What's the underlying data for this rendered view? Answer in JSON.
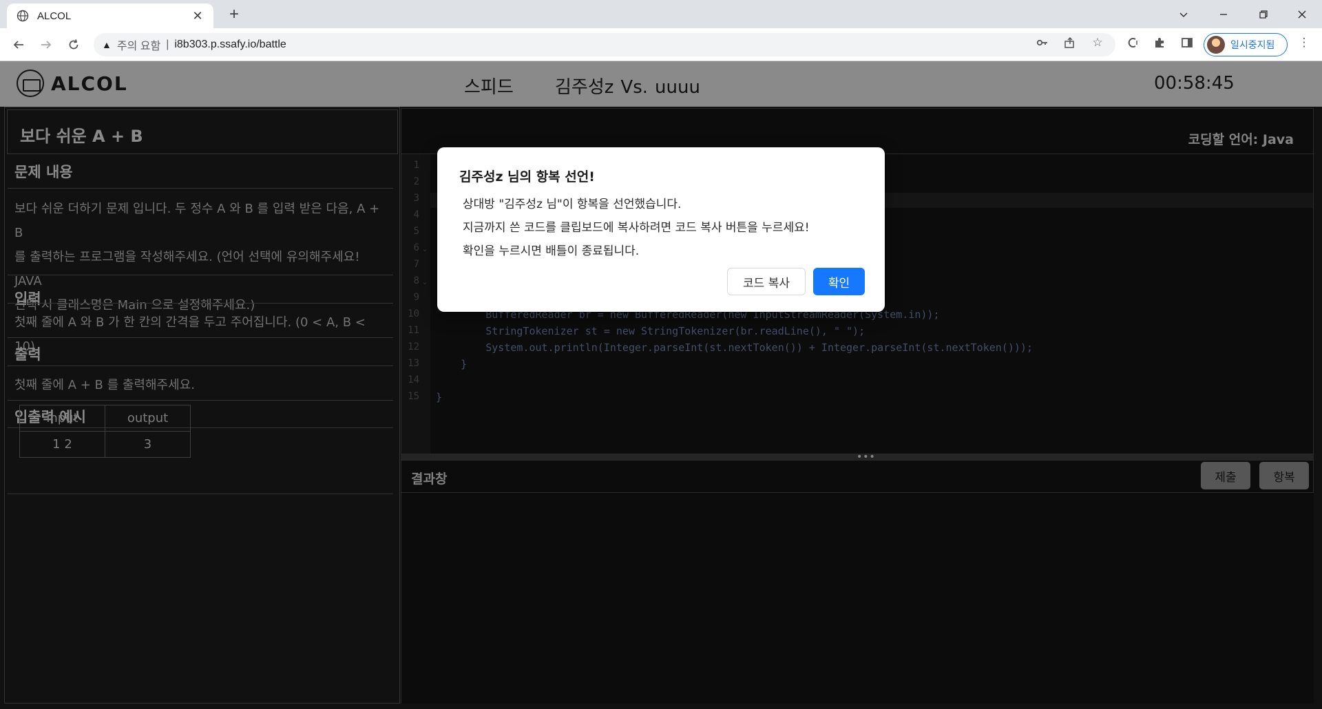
{
  "browser": {
    "tab_title": "ALCOL",
    "tab_close": "✕",
    "new_tab": "+",
    "security_warning": "주의 요함",
    "separator": "|",
    "url": "i8b303.p.ssafy.io/battle",
    "profile_label": "일시중지됨"
  },
  "header": {
    "logo_text": "ALCOL",
    "mode": "스피드",
    "player1": "김주성z",
    "vs": "Vs.",
    "player2": "uuuu",
    "timer": "00:58:45"
  },
  "problem": {
    "title": "보다 쉬운 A + B",
    "description_heading": "문제 내용",
    "description_lines": [
      "보다 쉬운 더하기 문제 입니다. 두 정수 A 와 B 를 입력 받은 다음, A + B",
      "를 출력하는 프로그램을 작성해주세요. (언어 선택에 유의해주세요! JAVA",
      "선택 시 클래스명은 Main 으로 설정해주세요.)"
    ],
    "input_heading": "입력",
    "input_text": "첫째 줄에 A 와 B 가 한 칸의 간격을 두고 주어집니다. (0 < A, B < 10)",
    "output_heading": "출력",
    "output_text": "첫째 줄에 A + B 를 출력해주세요.",
    "examples_heading": "입출력 예시",
    "examples_table": {
      "headers": [
        "input",
        "output"
      ],
      "rows": [
        [
          "1 2",
          "3"
        ]
      ]
    }
  },
  "editor": {
    "language_label": "코딩할 언어: Java",
    "line_numbers": [
      "1",
      "2",
      "3",
      "4",
      "5",
      "6",
      "7",
      "8",
      "9",
      "10",
      "11",
      "12",
      "13",
      "14",
      "15"
    ],
    "visible_code": {
      "line10": "        BufferedReader br = new BufferedReader(new InputStreamReader(System.in));",
      "line11": "        StringTokenizer st = new StringTokenizer(br.readLine(), \" \");",
      "line12": "        System.out.println(Integer.parseInt(st.nextToken()) + Integer.parseInt(st.nextToken()));",
      "line13": "    }",
      "line15": "}"
    }
  },
  "result": {
    "title": "결과창",
    "submit_label": "제출",
    "surrender_label": "항복",
    "splitter": "•••"
  },
  "modal": {
    "title": "김주성z 님의 항복 선언!",
    "line1": "상대방 \"김주성z 님\"이 항복을 선언했습니다.",
    "line2": "지금까지 쓴 코드를 클립보드에 복사하려면 코드 복사 버튼을 누르세요!",
    "line3": "확인을 누르시면 배틀이 종료됩니다.",
    "copy_label": "코드 복사",
    "ok_label": "확인"
  },
  "colors": {
    "accent": "#1677ff",
    "header_bg": "#8a8a8a",
    "panel_bg": "#1c1c1e"
  }
}
